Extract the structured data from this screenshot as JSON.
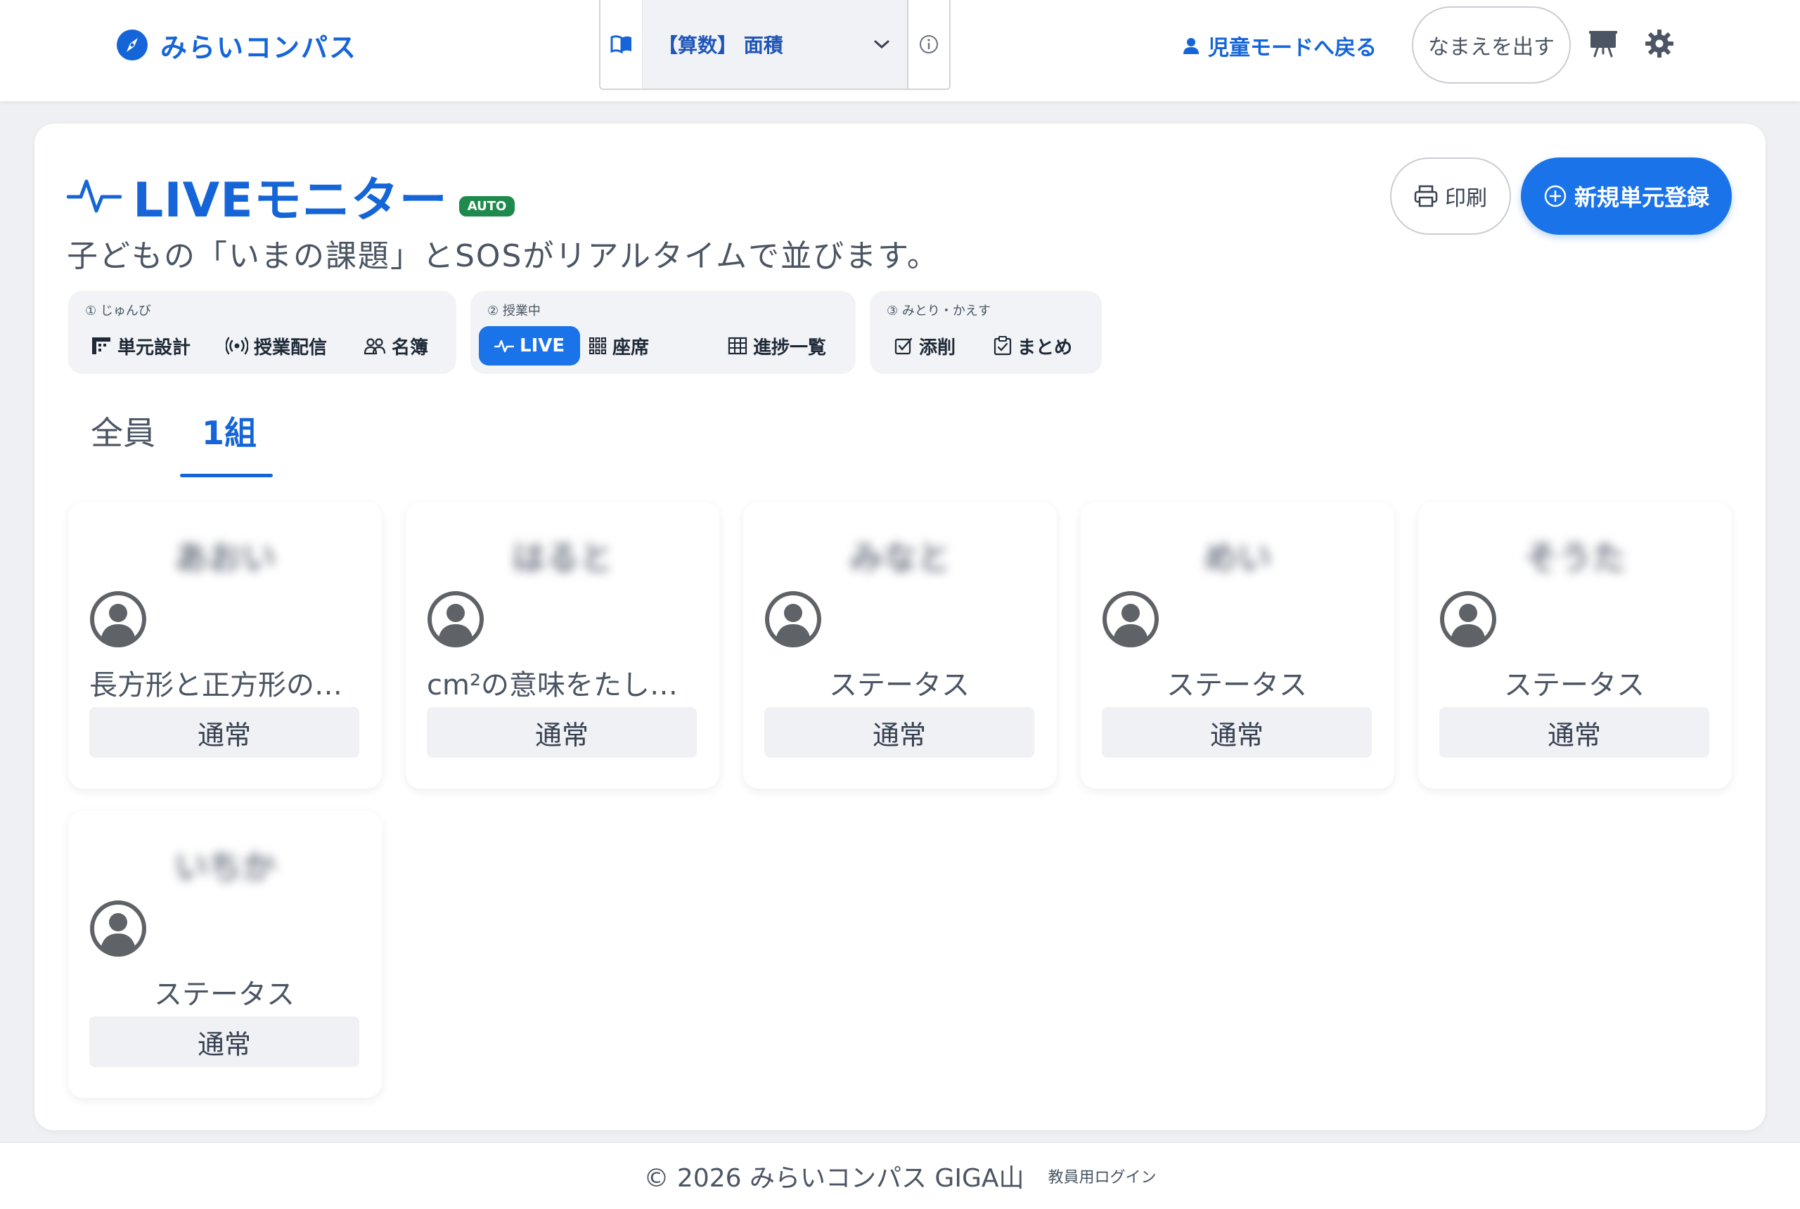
{
  "header": {
    "brand_name": "みらいコンパス",
    "subject_selected": "【算数】 面積",
    "child_mode_label": "児童モードへ戻る",
    "name_button_label": "なまえを出す"
  },
  "page": {
    "title": "LIVEモニター",
    "badge": "AUTO",
    "subtitle": "子どもの「いまの課題」とSOSがリアルタイムで並びます。",
    "print_label": "印刷",
    "new_unit_label": "新規単元登録"
  },
  "steps": [
    {
      "label": "① じゅんび",
      "items": [
        {
          "label": "単元設計",
          "icon": "blueprint-icon"
        },
        {
          "label": "授業配信",
          "icon": "broadcast-icon"
        },
        {
          "label": "名簿",
          "icon": "users-icon"
        }
      ]
    },
    {
      "label": "② 授業中",
      "items": [
        {
          "label": "LIVE",
          "icon": "pulse-icon",
          "active": true
        },
        {
          "label": "座席",
          "icon": "grid-icon"
        },
        {
          "label": "進捗一覧",
          "icon": "table-icon"
        }
      ]
    },
    {
      "label": "③ みとり・かえす",
      "items": [
        {
          "label": "添削",
          "icon": "check-square-icon"
        },
        {
          "label": "まとめ",
          "icon": "clipboard-check-icon"
        }
      ]
    }
  ],
  "tabs": [
    {
      "label": "全員",
      "active": false
    },
    {
      "label": "1組",
      "active": true
    }
  ],
  "students": [
    {
      "name": "あおい",
      "status": "長方形と正方形の…",
      "badge": "通常"
    },
    {
      "name": "はると",
      "status": "cm²の意味をたし…",
      "badge": "通常"
    },
    {
      "name": "みなと",
      "status": "ステータス",
      "badge": "通常"
    },
    {
      "name": "めい",
      "status": "ステータス",
      "badge": "通常"
    },
    {
      "name": "そうた",
      "status": "ステータス",
      "badge": "通常"
    },
    {
      "name": "いちか",
      "status": "ステータス",
      "badge": "通常"
    }
  ],
  "footer": {
    "copyright": "© 2026 みらいコンパス GIGA山",
    "teacher_login": "教員用ログイン"
  },
  "colors": {
    "accent": "#1a73e8",
    "brand": "#1565d8",
    "auto_badge": "#1e8a4c"
  }
}
